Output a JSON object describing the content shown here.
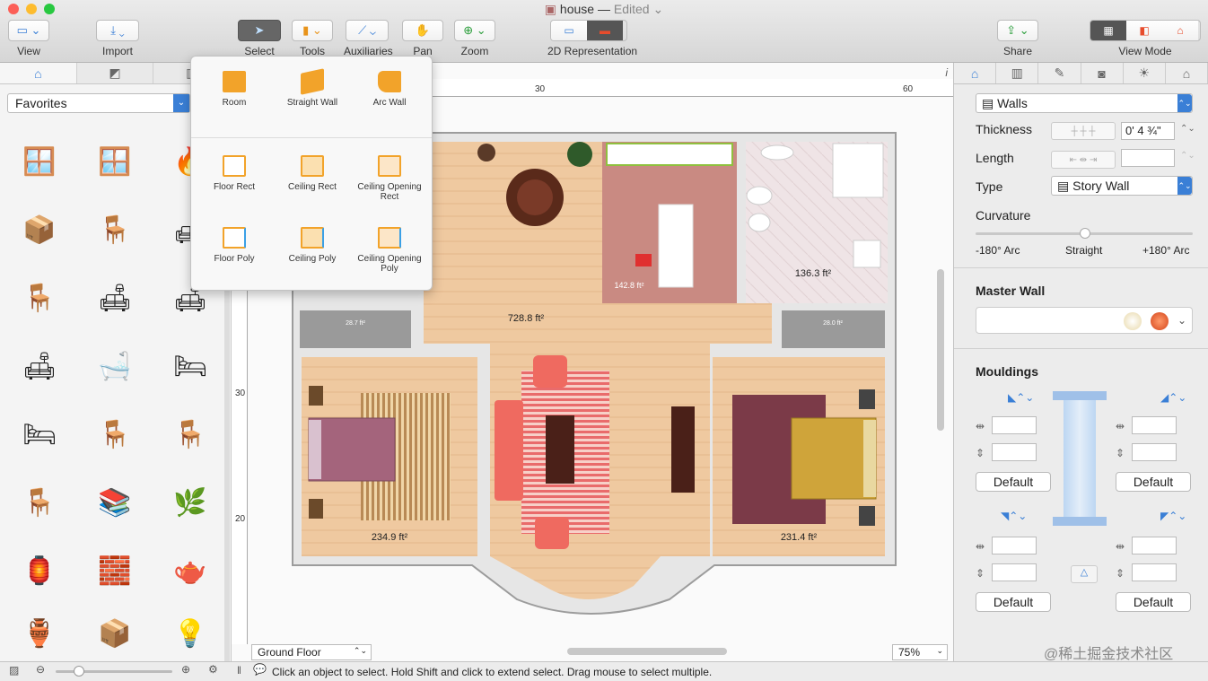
{
  "window": {
    "title": "house",
    "status": "Edited"
  },
  "toolbar": {
    "view": "View",
    "import": "Import",
    "select": "Select",
    "tools": "Tools",
    "auxiliaries": "Auxiliaries",
    "pan": "Pan",
    "zoom": "Zoom",
    "representation": "2D Representation",
    "share": "Share",
    "view_mode": "View Mode"
  },
  "tools_popup": {
    "items": [
      "Room",
      "Straight Wall",
      "Arc Wall",
      "Floor Rect",
      "Ceiling Rect",
      "Ceiling Opening Rect",
      "Floor Poly",
      "Ceiling Poly",
      "Ceiling Opening Poly"
    ]
  },
  "library": {
    "category": "Favorites",
    "icons": [
      "window-icon",
      "arched-window-icon",
      "fireplace-icon",
      "box-icon",
      "egg-chair-icon",
      "armchair-icon",
      "pink-chair-icon",
      "pink-armchair-icon",
      "pink-sofa-icon",
      "yellow-sofa-icon",
      "bathtub-icon",
      "bed-icon",
      "single-bed-icon",
      "red-chair-icon",
      "blue-chair-icon",
      "wooden-chair-icon",
      "bookshelf-icon",
      "plant-icon",
      "lantern-icon",
      "fireplace-brick-icon",
      "teapot-icon",
      "jar-icon",
      "box-small-icon",
      "lamp-icon"
    ]
  },
  "ruler": {
    "top": [
      "30",
      "60"
    ],
    "left": [
      "30",
      "20"
    ]
  },
  "plan": {
    "rooms": [
      "728.8 ft²",
      "142.8 ft²",
      "136.3 ft²",
      "234.9 ft²",
      "231.4 ft²",
      "28.7 ft²",
      "28.0 ft²"
    ]
  },
  "canvas": {
    "floor": "Ground Floor",
    "zoom": "75%"
  },
  "inspector": {
    "object_type": "Walls",
    "thickness_label": "Thickness",
    "thickness_value": "0' 4 ¾\"",
    "length_label": "Length",
    "type_label": "Type",
    "type_value": "Story Wall",
    "curvature_label": "Curvature",
    "arc_min": "-180° Arc",
    "arc_mid": "Straight",
    "arc_max": "+180° Arc",
    "master_wall": "Master Wall",
    "mouldings": "Mouldings",
    "default": "Default"
  },
  "status": "Click an object to select. Hold Shift and click to extend select. Drag mouse to select multiple.",
  "watermark": "@稀土掘金技术社区"
}
